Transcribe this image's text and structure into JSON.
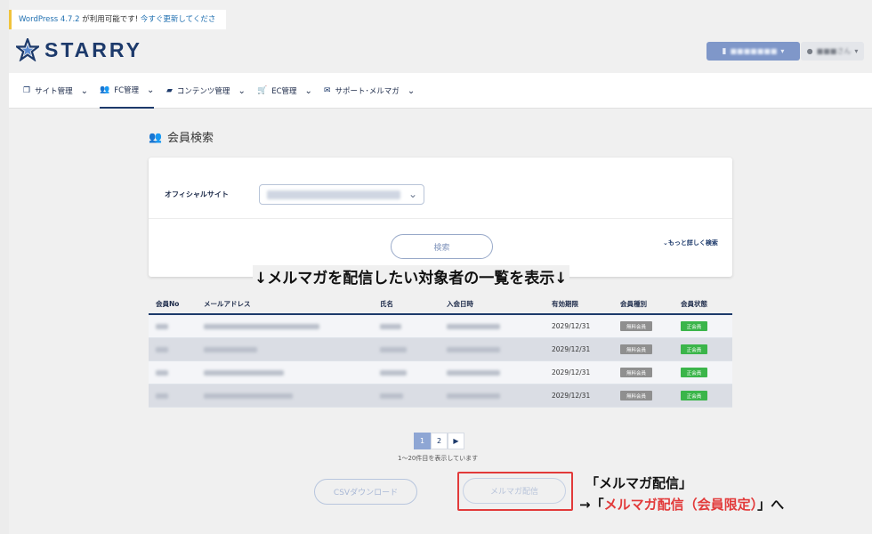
{
  "notice": {
    "link_version": "WordPress 4.7.2",
    "text": " が利用可能です! ",
    "link_update": "今すぐ更新してください。"
  },
  "header": {
    "logo_text": "STARRY",
    "site_button": "■■■■■■■",
    "user_button": "■■■さん"
  },
  "nav": {
    "items": [
      {
        "label": "サイト管理",
        "icon": "copy-icon"
      },
      {
        "label": "FC管理",
        "icon": "users-icon"
      },
      {
        "label": "コンテンツ管理",
        "icon": "folder-icon"
      },
      {
        "label": "EC管理",
        "icon": "cart-icon"
      },
      {
        "label": "サポート･メルマガ",
        "icon": "envelope-icon"
      }
    ]
  },
  "page": {
    "title": "会員検索",
    "title_icon": "users-icon"
  },
  "search": {
    "site_label": "オフィシャルサイト",
    "search_button": "検索",
    "more_link": "⌄もっと詳しく検索"
  },
  "annotation_top": "↓メルマガを配信したい対象者の一覧を表示↓",
  "table": {
    "headers": [
      "会員No",
      "メールアドレス",
      "氏名",
      "入会日時",
      "有効期限",
      "会員種別",
      "会員状態"
    ],
    "rows": [
      {
        "expiry": "2029/12/31",
        "type": "無料会員",
        "status": "正会員"
      },
      {
        "expiry": "2029/12/31",
        "type": "無料会員",
        "status": "正会員"
      },
      {
        "expiry": "2029/12/31",
        "type": "無料会員",
        "status": "正会員"
      },
      {
        "expiry": "2029/12/31",
        "type": "無料会員",
        "status": "正会員"
      }
    ]
  },
  "pager": {
    "pages": [
      "1",
      "2"
    ],
    "next": "▶",
    "note": "1〜20件目を表示しています"
  },
  "actions": {
    "csv_button": "CSVダウンロード",
    "mag_button": "メルマガ配信"
  },
  "annotation_bottom": {
    "line1": "「メルマガ配信」",
    "line2_prefix": "→「",
    "line2_red": "メルマガ配信（会員限定）",
    "line2_suffix": "」へ"
  },
  "colors": {
    "brand": "#1d3a6b",
    "highlight": "#e23a3a",
    "status_green": "#3bb54a",
    "type_gray": "#8f8f8f"
  }
}
